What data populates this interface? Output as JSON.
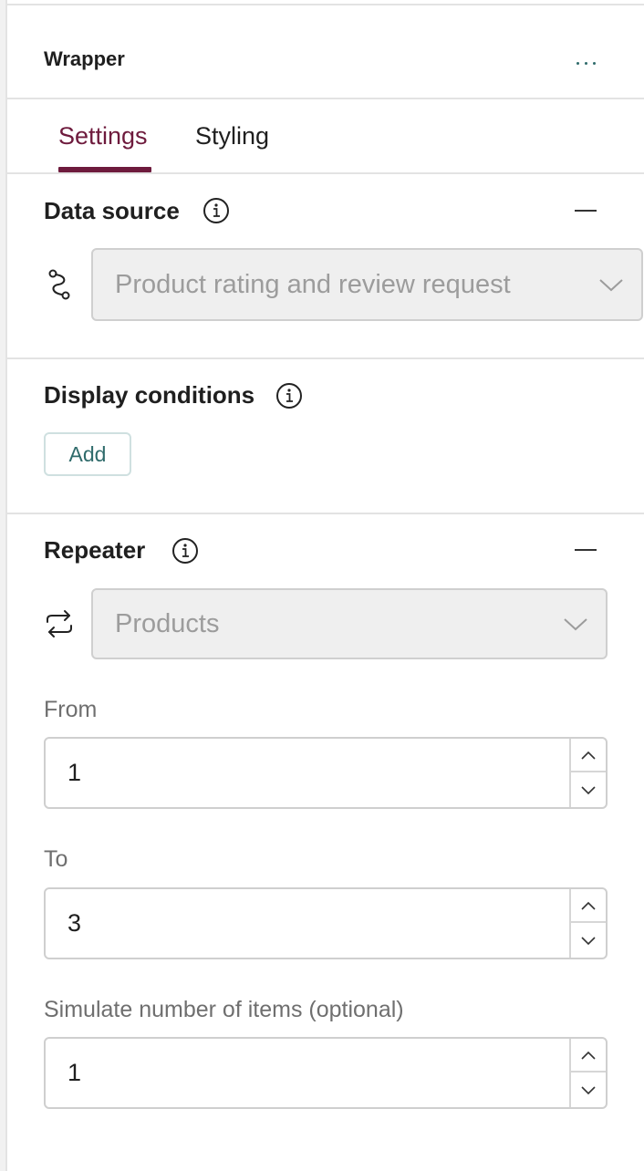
{
  "panel": {
    "title": "Wrapper",
    "more_icon": "ellipsis-icon"
  },
  "tabs": [
    {
      "label": "Settings",
      "active": true
    },
    {
      "label": "Styling",
      "active": false
    }
  ],
  "data_source": {
    "heading": "Data source",
    "icon": "data-path-icon",
    "selected": "Product rating and review request"
  },
  "display_conditions": {
    "heading": "Display conditions",
    "add_label": "Add"
  },
  "repeater": {
    "heading": "Repeater",
    "icon": "repeat-icon",
    "selected": "Products",
    "from_label": "From",
    "from_value": "1",
    "to_label": "To",
    "to_value": "3",
    "simulate_label": "Simulate number of items (optional)",
    "simulate_value": "1"
  },
  "colors": {
    "accent": "#6e1b3d",
    "button_text": "#2f6b6b",
    "select_bg": "#efefef"
  }
}
